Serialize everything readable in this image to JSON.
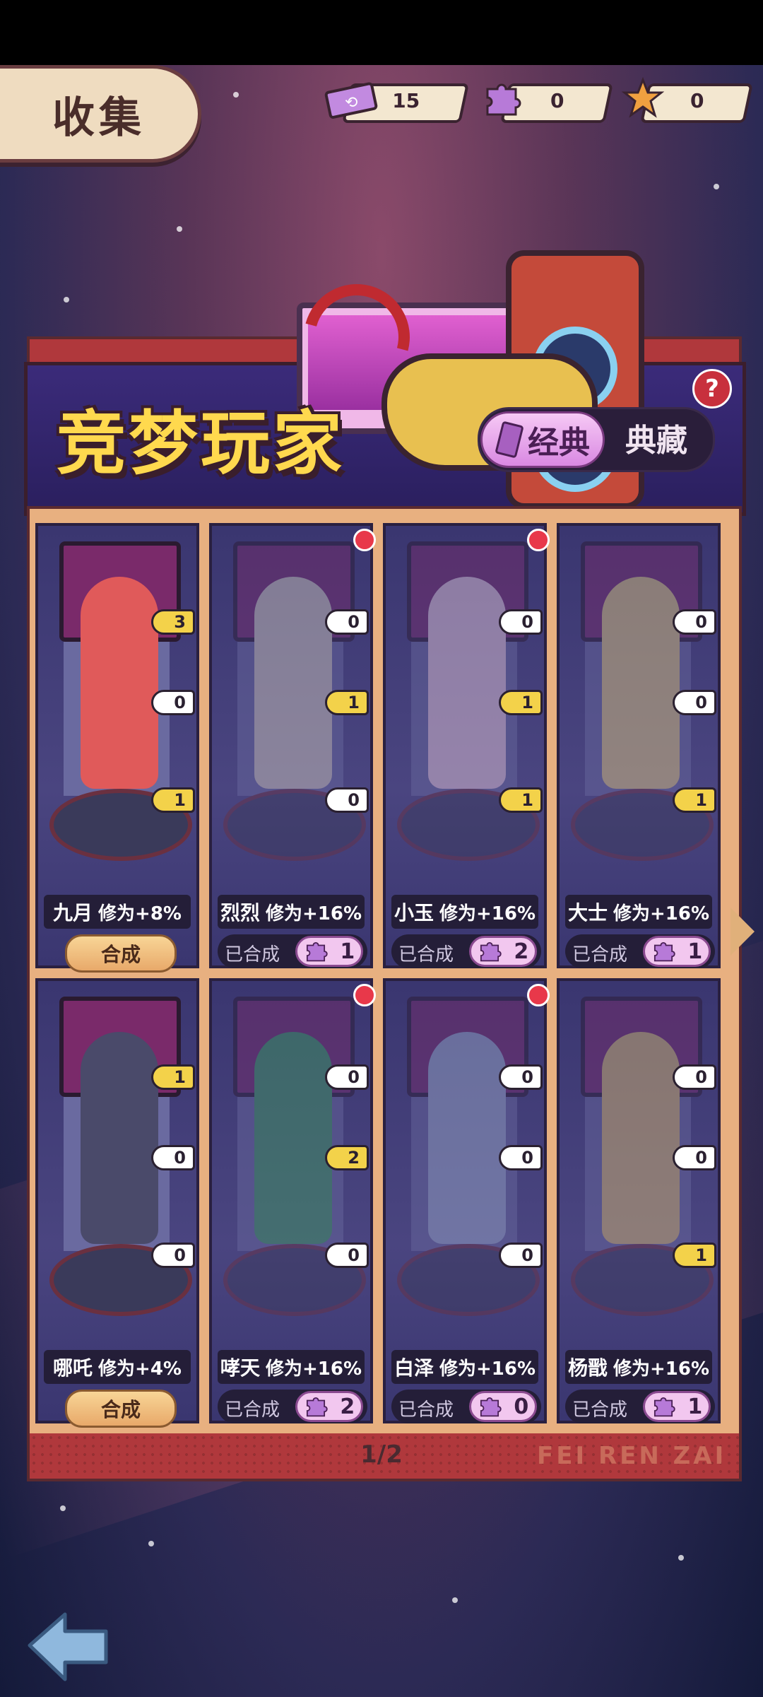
{
  "header": {
    "title": "收集"
  },
  "currencies": [
    {
      "icon": "ticket-icon",
      "value": "15"
    },
    {
      "icon": "puzzle-piece-icon",
      "value": "0"
    },
    {
      "icon": "star-icon",
      "value": "0"
    }
  ],
  "banner": {
    "title": "竞梦玩家",
    "tabs": [
      {
        "label": "经典",
        "active": true
      },
      {
        "label": "典藏",
        "active": false
      }
    ],
    "help": "?"
  },
  "cards": [
    {
      "name": "九月",
      "bonus": "修为+8%",
      "badges": [
        "3",
        "0",
        "1"
      ],
      "status": "synth",
      "action_label": "合成",
      "red_dot": false
    },
    {
      "name": "烈烈",
      "bonus": "修为+16%",
      "badges": [
        "0",
        "1",
        "0"
      ],
      "status": "done",
      "done_label": "已合成",
      "fragments": "1",
      "red_dot": true
    },
    {
      "name": "小玉",
      "bonus": "修为+16%",
      "badges": [
        "0",
        "1",
        "1"
      ],
      "status": "done",
      "done_label": "已合成",
      "fragments": "2",
      "red_dot": true
    },
    {
      "name": "大士",
      "bonus": "修为+16%",
      "badges": [
        "0",
        "0",
        "1"
      ],
      "status": "done",
      "done_label": "已合成",
      "fragments": "1",
      "red_dot": false
    },
    {
      "name": "哪吒",
      "bonus": "修为+4%",
      "badges": [
        "1",
        "0",
        "0"
      ],
      "status": "synth",
      "action_label": "合成",
      "red_dot": false
    },
    {
      "name": "哮天",
      "bonus": "修为+16%",
      "badges": [
        "0",
        "2",
        "0"
      ],
      "status": "done",
      "done_label": "已合成",
      "fragments": "2",
      "red_dot": true
    },
    {
      "name": "白泽",
      "bonus": "修为+16%",
      "badges": [
        "0",
        "0",
        "0"
      ],
      "status": "done",
      "done_label": "已合成",
      "fragments": "0",
      "red_dot": true
    },
    {
      "name": "杨戬",
      "bonus": "修为+16%",
      "badges": [
        "0",
        "0",
        "1"
      ],
      "status": "done",
      "done_label": "已合成",
      "fragments": "1",
      "red_dot": false
    }
  ],
  "pagination": {
    "text": "1/2"
  },
  "watermark": "FEI REN ZAI",
  "colors": {
    "accent_gold": "#ffd94e",
    "panel_red": "#b0383c",
    "card_bg": "#3a3670",
    "badge_gold": "#f3d24a",
    "dot_red": "#e8384a"
  }
}
